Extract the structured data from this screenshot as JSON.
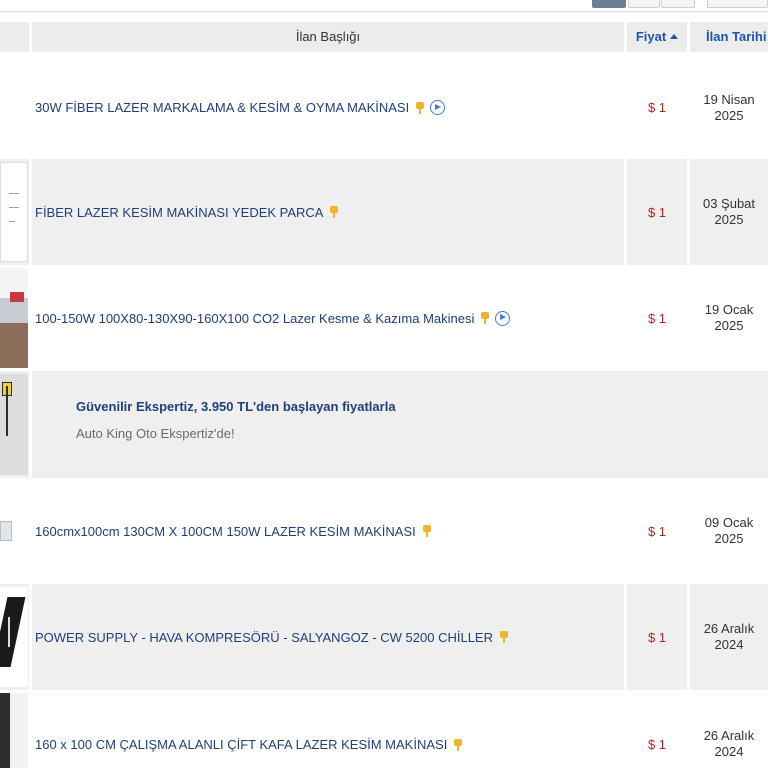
{
  "table": {
    "headers": {
      "title": "İlan Başlığı",
      "price": "Fiyat",
      "date": "İlan Tarihi"
    },
    "rows": [
      {
        "title": "30W FİBER LAZER MARKALAMA & KESİM & OYMA MAKİNASI",
        "price": "$ 1",
        "date": "19 Nisan\n2025",
        "has_video": true
      },
      {
        "title": "FİBER LAZER KESİM MAKİNASI YEDEK PARCA",
        "price": "$ 1",
        "date": "03 Şubat\n2025",
        "has_video": false
      },
      {
        "title": "100-150W 100X80-130X90-160X100 CO2 Lazer Kesme & Kazıma Makinesi",
        "price": "$ 1",
        "date": "19 Ocak\n2025",
        "has_video": true
      },
      {
        "title": "160cmx100cm 130CM X 100CM 150W LAZER KESİM MAKİNASI",
        "price": "$ 1",
        "date": "09 Ocak\n2025",
        "has_video": false
      },
      {
        "title": "POWER SUPPLY - HAVA KOMPRESÖRÜ - SALYANGOZ - CW 5200 CHİLLER",
        "price": "$ 1",
        "date": "26 Aralık\n2024",
        "has_video": false
      },
      {
        "title": "160 x 100 CM ÇALIŞMA ALANLI ÇİFT KAFA LAZER KESİM MAKİNASI",
        "price": "$ 1",
        "date": "26 Aralık\n2024",
        "has_video": false
      }
    ]
  },
  "ad": {
    "title": "Güvenilir Ekspertiz, 3.950 TL'den başlayan fiyatlarla",
    "subtitle": "Auto King Oto Ekspertiz'de!"
  },
  "icons": {
    "highlight": "pin-icon",
    "video": "play-icon"
  },
  "colors": {
    "link": "#1f3f7a",
    "price": "#b3261e",
    "header_active": "#1f56a8",
    "highlight_icon": "#f0b428",
    "video_icon": "#3d7fd1"
  }
}
